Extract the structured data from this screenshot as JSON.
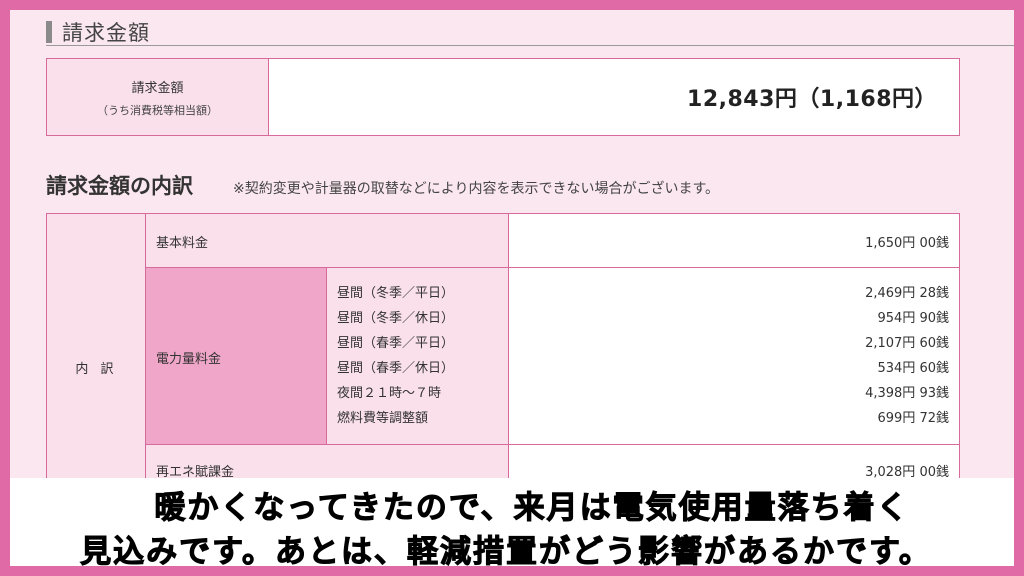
{
  "section_title": "請求金額",
  "total": {
    "label": "請求金額",
    "sub_label": "（うち消費税等相当額）",
    "value": "12,843円（1,168円）"
  },
  "breakdown": {
    "heading": "請求金額の内訳",
    "note": "※契約変更や計量器の取替などにより内容を表示できない場合がございます。",
    "category_label": "内 訳",
    "basic": {
      "label": "基本料金",
      "value": "1,650円 00銭"
    },
    "energy": {
      "label": "電力量料金",
      "items": [
        {
          "label": "昼間（冬季／平日）",
          "value": "2,469円 28銭"
        },
        {
          "label": "昼間（冬季／休日）",
          "value": "954円 90銭"
        },
        {
          "label": "昼間（春季／平日）",
          "value": "2,107円 60銭"
        },
        {
          "label": "昼間（春季／休日）",
          "value": "534円 60銭"
        },
        {
          "label": "夜間２１時～７時",
          "value": "4,398円 93銭"
        },
        {
          "label": "燃料費等調整額",
          "value": "699円 72銭"
        }
      ]
    },
    "renewable": {
      "label": "再エネ賦課金",
      "value": "3,028円 00銭"
    }
  },
  "subtitles": {
    "line1": "暖かくなってきたので、来月は電気使用量落ち着く",
    "line2": "見込みです。あとは、軽減措置がどう影響があるかです。"
  }
}
